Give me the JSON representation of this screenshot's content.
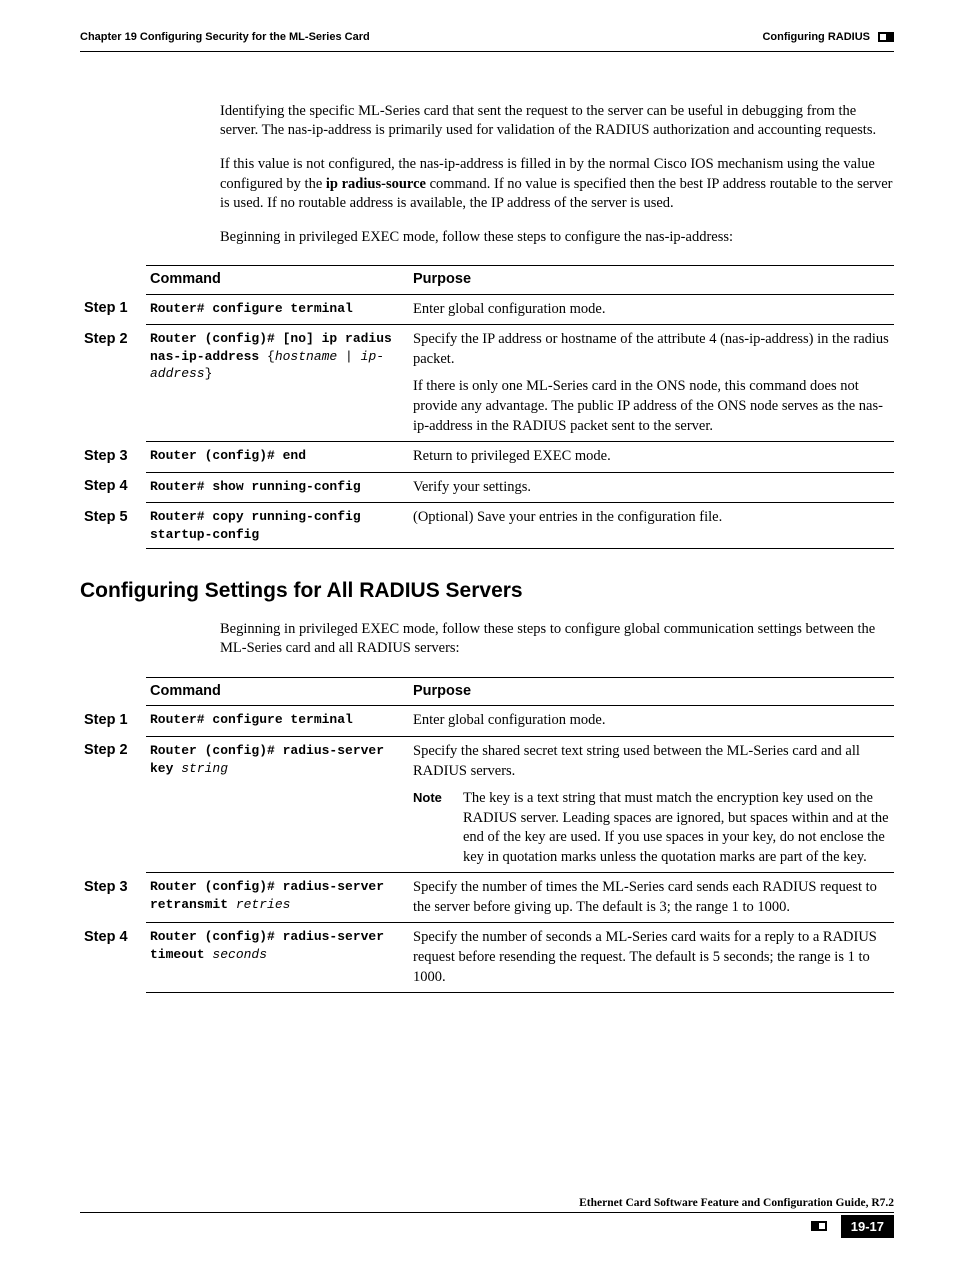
{
  "header": {
    "chapter": "Chapter 19   Configuring Security for the ML-Series Card",
    "section": "Configuring RADIUS"
  },
  "intro": {
    "p1": "Identifying the specific ML-Series card that sent the request to the server can be useful in debugging from the server. The nas-ip-address is primarily used for validation of the RADIUS authorization and accounting requests.",
    "p2_a": "If this value is not configured, the nas-ip-address is filled in by the normal Cisco IOS mechanism using the value configured by the ",
    "p2_bold": "ip radius-source",
    "p2_b": " command. If no value is specified then the best IP address routable to the server is used. If no routable address is available, the IP address of the server is used.",
    "p3": "Beginning in privileged EXEC mode, follow these steps to configure the nas-ip-address:"
  },
  "table1": {
    "h_command": "Command",
    "h_purpose": "Purpose",
    "rows": [
      {
        "step": "Step 1",
        "cmd_bold": "Router# configure terminal",
        "purpose": "Enter global configuration mode."
      },
      {
        "step": "Step 2",
        "cmd_bold_a": "Router (config)# [no] ip radius nas-ip-address",
        "cmd_plain": " {",
        "cmd_italic_a": "hostname",
        "cmd_plain2": " | ",
        "cmd_italic_b": "ip-address",
        "cmd_plain3": "}",
        "purpose_p1": "Specify the IP address or hostname of the attribute 4 (nas-ip-address) in the radius packet.",
        "purpose_p2": "If there is only one ML-Series card in the ONS node, this command does not provide any advantage. The public IP address of the ONS node serves as the nas-ip-address in the RADIUS packet sent to the server."
      },
      {
        "step": "Step 3",
        "cmd_bold": "Router (config)# end",
        "purpose": "Return to privileged EXEC mode."
      },
      {
        "step": "Step 4",
        "cmd_bold": "Router# show running-config",
        "purpose": "Verify your settings."
      },
      {
        "step": "Step 5",
        "cmd_bold": "Router# copy running-config startup-config",
        "purpose": "(Optional) Save your entries in the configuration file."
      }
    ]
  },
  "section2": {
    "heading": "Configuring Settings for All RADIUS Servers",
    "intro": "Beginning in privileged EXEC mode, follow these steps to configure global communication settings between the ML-Series card and all RADIUS servers:"
  },
  "table2": {
    "h_command": "Command",
    "h_purpose": "Purpose",
    "rows": [
      {
        "step": "Step 1",
        "cmd_bold": "Router# configure terminal",
        "purpose": "Enter global configuration mode."
      },
      {
        "step": "Step 2",
        "cmd_bold": "Router (config)# radius-server key",
        "cmd_italic": " string",
        "purpose_p1": "Specify the shared secret text string used between the ML-Series card and all RADIUS servers.",
        "note_label": "Note",
        "note_text": "The key is a text string that must match the encryption key used on the RADIUS server. Leading spaces are ignored, but spaces within and at the end of the key are used. If you use spaces in your key, do not enclose the key in quotation marks unless the quotation marks are part of the key."
      },
      {
        "step": "Step 3",
        "cmd_bold": "Router (config)# radius-server retransmit",
        "cmd_italic": " retries",
        "purpose": "Specify the number of times the ML-Series card sends each RADIUS request to the server before giving up. The default is 3; the range 1 to 1000."
      },
      {
        "step": "Step 4",
        "cmd_bold": "Router (config)# radius-server timeout",
        "cmd_italic": " seconds",
        "purpose": "Specify the number of seconds a ML-Series card waits for a reply to a RADIUS request before resending the request. The default is 5 seconds; the range is 1 to 1000."
      }
    ]
  },
  "footer": {
    "guide": "Ethernet Card Software Feature and Configuration Guide, R7.2",
    "page": "19-17"
  }
}
